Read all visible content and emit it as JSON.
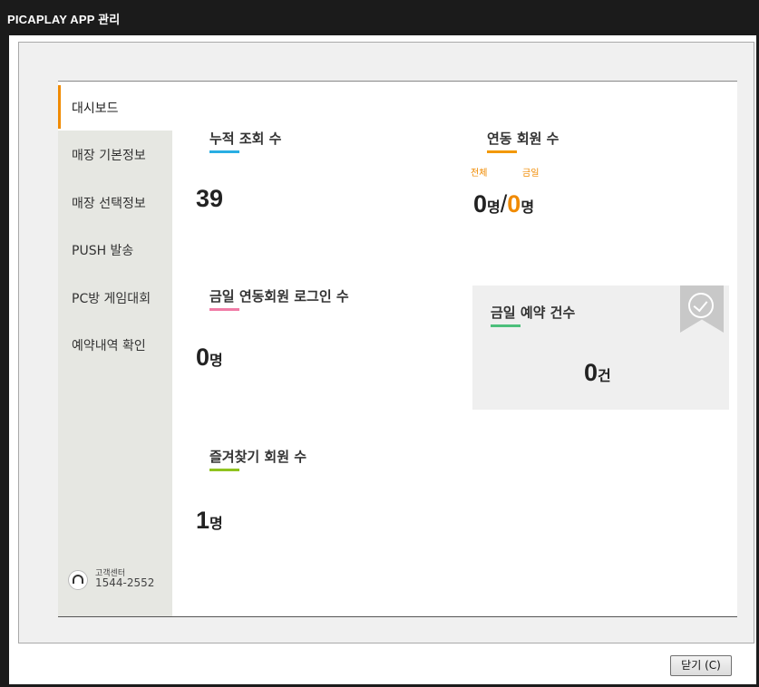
{
  "window": {
    "title": "PICAPLAY APP 관리"
  },
  "sidebar": {
    "active": "대시보드",
    "items": [
      "매장 기본정보",
      "매장 선택정보",
      "PUSH 발송",
      "PC방 게임대회",
      "예약내역 확인"
    ],
    "support": {
      "label": "고객센터",
      "phone": "1544-2552"
    }
  },
  "stats": {
    "views": {
      "title": "누적 조회 수",
      "value": "39"
    },
    "linked": {
      "title": "연동 회원 수",
      "total_label": "전체",
      "today_label": "금일",
      "total": "0",
      "today": "0",
      "unit": "명",
      "sep": "/"
    },
    "login": {
      "title": "금일 연동회원 로그인 수",
      "value": "0",
      "unit": "명"
    },
    "favorites": {
      "title": "즐겨찾기 회원 수",
      "value": "1",
      "unit": "명"
    },
    "reservations": {
      "title": "금일 예약 건수",
      "value": "0",
      "unit": "건"
    }
  },
  "footer": {
    "close_label": "닫기 (C)"
  },
  "colors": {
    "views": "#29aee3",
    "linked": "#f39800",
    "login": "#f07ba6",
    "favorites": "#8fc31f",
    "reservations": "#4cbf7b",
    "accent": "#f08a00"
  }
}
